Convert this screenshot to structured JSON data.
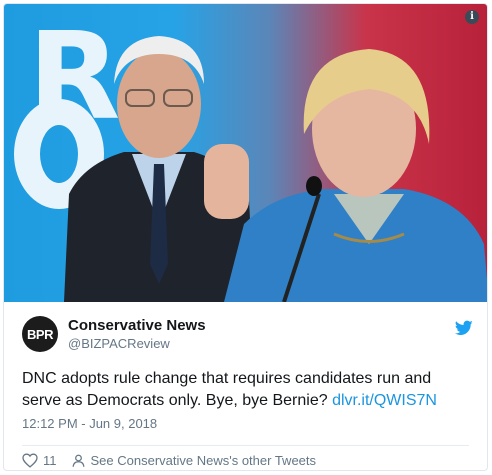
{
  "tweet": {
    "author_name": "Conservative News",
    "author_handle": "@BIZPACReview",
    "avatar_text": "BPR",
    "text_main": "DNC adopts rule change that requires candidates run and serve as Democrats only. Bye, bye Bernie? ",
    "text_link": "dlvr.it/QWIS7N",
    "timestamp": "12:12 PM - Jun 9, 2018",
    "like_count": "11",
    "other_tweets_link": "See Conservative News's other Tweets"
  },
  "media": {
    "info_label": "i",
    "sign_letters": [
      "R",
      "O"
    ]
  },
  "colors": {
    "link": "#1b95e0",
    "twitter_blue": "#1da1f2",
    "text": "#14171a",
    "muted": "#657786"
  }
}
